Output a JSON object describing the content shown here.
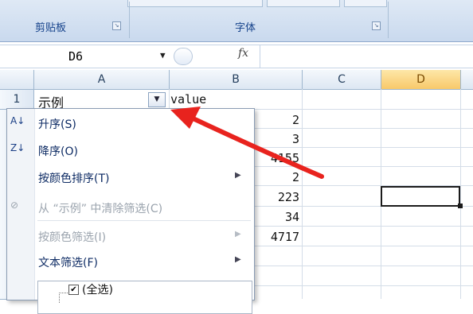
{
  "ribbon": {
    "groups": [
      {
        "label": "剪贴板"
      },
      {
        "label": "字体"
      }
    ]
  },
  "formula_bar": {
    "name_box": "D6",
    "fx_label": "fx",
    "formula": ""
  },
  "columns": [
    "A",
    "B",
    "C",
    "D"
  ],
  "rows": [
    "1"
  ],
  "cells": {
    "a1": "示例",
    "b1": "value",
    "b_values": [
      "2",
      "3",
      "4155",
      "2",
      "223",
      "34",
      "4717"
    ]
  },
  "filter_menu": {
    "items": [
      {
        "label": "升序(S)",
        "icon": "sort-ascending-icon",
        "enabled": true,
        "submenu": false
      },
      {
        "label": "降序(O)",
        "icon": "sort-descending-icon",
        "enabled": true,
        "submenu": false
      },
      {
        "label": "按颜色排序(T)",
        "icon": "",
        "enabled": true,
        "submenu": true
      },
      {
        "label": "从 “示例” 中清除筛选(C)",
        "icon": "clear-filter-icon",
        "enabled": false,
        "submenu": false
      },
      {
        "label": "按颜色筛选(I)",
        "icon": "",
        "enabled": false,
        "submenu": true
      },
      {
        "label": "文本筛选(F)",
        "icon": "",
        "enabled": true,
        "submenu": true
      }
    ],
    "list": {
      "select_all": "(全选)",
      "checked": true
    }
  },
  "colors": {
    "annotation_arrow": "#e8231e",
    "selected_column_header": "#f8c96a",
    "menu_text": "#0c2a63"
  }
}
